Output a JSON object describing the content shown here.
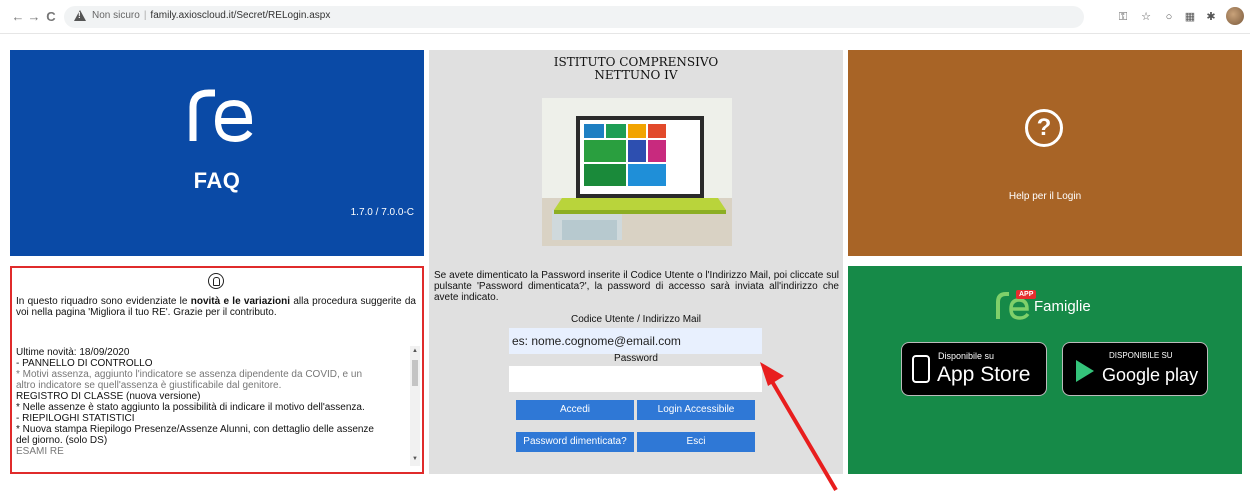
{
  "browser": {
    "back": "←",
    "forward": "→",
    "reload": "C",
    "security_label": "Non sicuro",
    "url": "family.axioscloud.it/Secret/RELogin.aspx"
  },
  "faq_panel": {
    "logo": "re",
    "title": "FAQ",
    "version": "1.7.0 / 7.0.0-C"
  },
  "login": {
    "school_name_1": "ISTITUTO COMPRENSIVO",
    "school_name_2": "NETTUNO IV",
    "info_text": "Se avete dimenticato la Password inserite il Codice Utente o l'Indirizzo Mail, poi cliccate sul pulsante 'Password dimenticata?', la password di accesso sarà inviata all'indirizzo che avete indicato.",
    "user_label": "Codice Utente / Indirizzo Mail",
    "user_value": "es: nome.cognome@email.com",
    "password_label": "Password",
    "password_value": "",
    "buttons": {
      "accedi": "Accedi",
      "login_accessibile": "Login Accessibile",
      "password_dimenticata": "Password dimenticata?",
      "esci": "Esci"
    },
    "button_color": "#2f78d6"
  },
  "help_panel": {
    "icon": "question-circle-icon",
    "text": "Help per il Login"
  },
  "news_panel": {
    "intro_1": "In questo riquadro sono evidenziate le ",
    "intro_bold": "novità e le variazioni",
    "intro_2": " alla procedura suggerite da voi nella pagina 'Migliora il tuo RE'. Grazie per il contributo.",
    "items": [
      "Ultime novità: 18/09/2020",
      "- PANNELLO DI CONTROLLO",
      "  * Motivi assenza, aggiunto l'indicatore se assenza dipendente da COVID, e un",
      "altro indicatore se quell'assenza è giustificabile dal genitore.",
      "  REGISTRO DI CLASSE (nuova versione)",
      "  * Nelle assenze è stato aggiunto la possibilità di indicare il motivo dell'assenza.",
      "- RIEPILOGHI STATISTICI",
      "  * Nuova stampa Riepilogo Presenze/Assenze Alunni, con dettaglio delle assenze",
      "del giorno. (solo DS)",
      "  ESAMI RE"
    ]
  },
  "apps_panel": {
    "logo": "re",
    "badge": "APP",
    "title": "Famiglie",
    "appstore_small": "Disponibile su",
    "appstore_big": "App Store",
    "google_small": "DISPONIBILE SU",
    "google_big": "Google play"
  },
  "colors": {
    "faq_bg": "#0a4aa6",
    "center_bg": "#e0e0e0",
    "help_bg": "#a86426",
    "apps_bg": "#168a48",
    "news_border": "#e02b2b",
    "arrow": "#e81e1e"
  }
}
